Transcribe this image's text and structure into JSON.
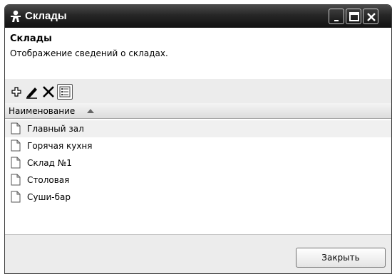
{
  "window": {
    "title": "Склады",
    "title_icon": "person-icon"
  },
  "info": {
    "title": "Склады",
    "description": "Отображение сведений о складах."
  },
  "toolbar": {
    "icons": [
      "add-icon",
      "edit-icon",
      "delete-icon",
      "view-details-icon"
    ]
  },
  "grid": {
    "column_header": "Наименование",
    "sort": "ascending",
    "rows": [
      {
        "label": "Главный зал",
        "selected": true
      },
      {
        "label": "Горячая кухня",
        "selected": false
      },
      {
        "label": "Склад №1",
        "selected": false
      },
      {
        "label": "Столовая",
        "selected": false
      },
      {
        "label": "Суши-бар",
        "selected": false
      }
    ]
  },
  "footer": {
    "close_label": "Закрыть"
  }
}
